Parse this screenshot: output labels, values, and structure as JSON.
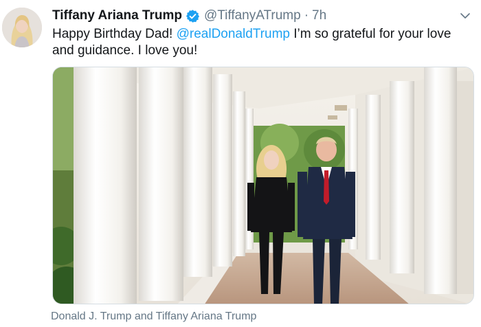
{
  "tweet": {
    "display_name": "Tiffany Ariana Trump",
    "handle": "@TiffanyATrump",
    "separator": "·",
    "time": "7h",
    "text_before": "Happy Birthday Dad! ",
    "mention": "@realDonaldTrump",
    "text_after": " I’m so grateful for your love and guidance. I love you!",
    "verified_icon": "verified-badge-icon",
    "menu_icon": "chevron-down-icon"
  },
  "media": {
    "caption": "Donald J. Trump and Tiffany Ariana Trump"
  },
  "colors": {
    "link": "#1da1f2",
    "secondary_text": "#657786",
    "primary_text": "#14171a"
  }
}
